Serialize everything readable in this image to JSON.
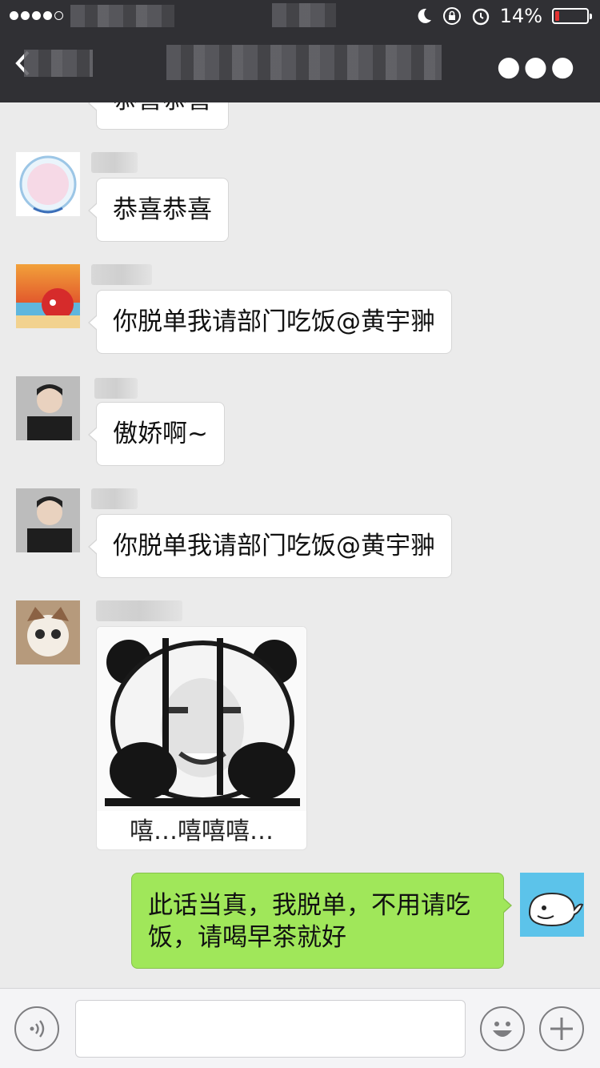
{
  "status": {
    "battery_percent": "14%",
    "battery_level": 0.14
  },
  "nav": {
    "back_icon": "chevron-left-icon",
    "more_label": "●●●"
  },
  "messages": [
    {
      "sender": "left",
      "text": "恭喜恭喜"
    },
    {
      "sender": "left",
      "text": "恭喜恭喜"
    },
    {
      "sender": "left",
      "text": "你脱单我请部门吃饭@黄宇翀"
    },
    {
      "sender": "left",
      "text": "傲娇啊~"
    },
    {
      "sender": "left",
      "text": "你脱单我请部门吃饭@黄宇翀"
    },
    {
      "sender": "left",
      "type": "sticker",
      "caption": "嘻…嘻嘻嘻…"
    },
    {
      "sender": "me",
      "text": "此话当真，我脱单，不用请吃饭，请喝早茶就好"
    }
  ],
  "colors": {
    "nav_bg": "#303034",
    "chat_bg": "#ebebeb",
    "my_bubble": "#a0e75a",
    "battery_low": "#e33333"
  }
}
